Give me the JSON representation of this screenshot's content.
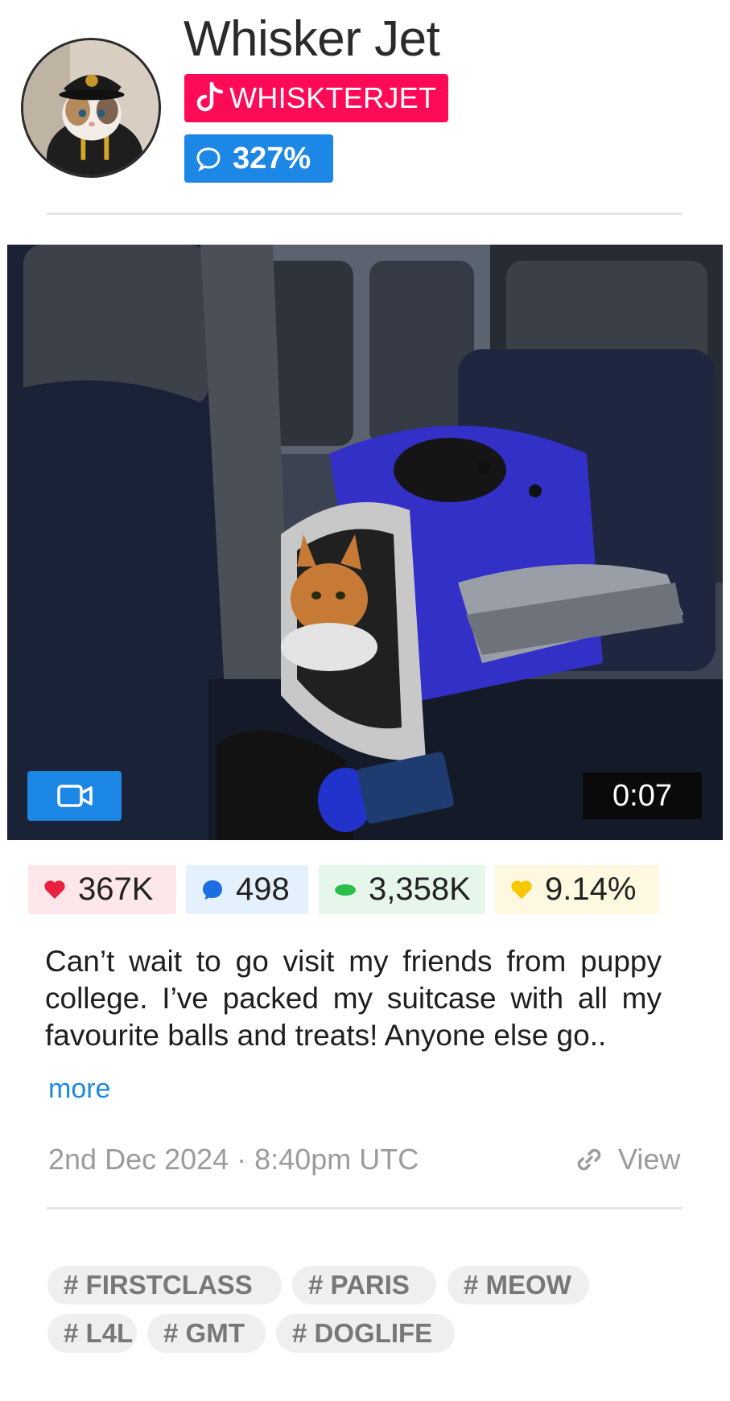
{
  "profile": {
    "name": "Whisker Jet",
    "handle": "WHISKTERJET",
    "engagement": "327%",
    "platform_icon": "tiktok-icon",
    "handle_color": "#fe0a57",
    "engagement_color": "#1c87e5"
  },
  "media": {
    "type_icon": "video-camera-icon",
    "duration": "0:07"
  },
  "stats": {
    "likes": "367K",
    "comments": "498",
    "views": "3,358K",
    "engagement_rate": "9.14%"
  },
  "post": {
    "caption": "Can’t wait to go visit my friends from puppy college. I’ve packed my suitcase with all my favourite balls and treats! Anyone else go..",
    "more_label": "more",
    "date": "2nd Dec 2024 · 8:40pm UTC",
    "view_label": "View"
  },
  "tags": [
    "FIRSTCLASS",
    "PARIS",
    "MEOW",
    "L4L",
    "GMT",
    "DOGLIFE"
  ]
}
